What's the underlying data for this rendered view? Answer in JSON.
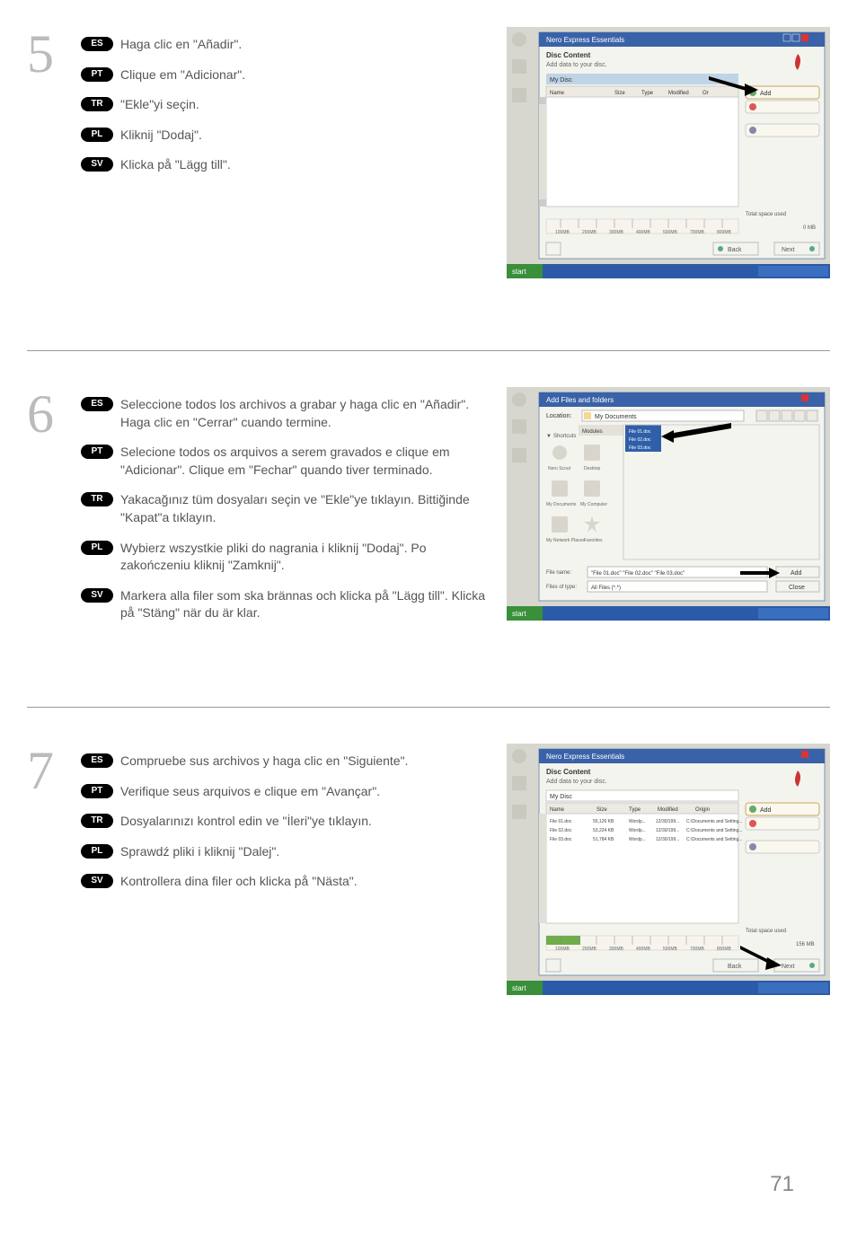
{
  "page_number": "71",
  "steps": [
    {
      "num": "5",
      "lines": [
        {
          "badge": "ES",
          "text": "Haga clic en \"Añadir\"."
        },
        {
          "badge": "PT",
          "text": "Clique em \"Adicionar\"."
        },
        {
          "badge": "TR",
          "text": "\"Ekle\"yi seçin."
        },
        {
          "badge": "PL",
          "text": "Kliknij \"Dodaj\"."
        },
        {
          "badge": "SV",
          "text": "Klicka på \"Lägg till\"."
        }
      ],
      "screenshot": {
        "title": "Nero Express Essentials",
        "heading": "Disc Content",
        "sub": "Add data to your disc.",
        "columns": [
          "Name",
          "Size",
          "Type",
          "Modified",
          "Or"
        ],
        "side_total": "Total space used",
        "side_add": "Add",
        "back": "Back",
        "next": "Next",
        "taskbar": "start",
        "arrow_to": "add"
      }
    },
    {
      "num": "6",
      "lines": [
        {
          "badge": "ES",
          "text": "Seleccione todos los archivos a grabar y haga clic en \"Añadir\". Haga clic en \"Cerrar\" cuando termine."
        },
        {
          "badge": "PT",
          "text": "Selecione todos os arquivos a serem gravados e clique em \"Adicionar\". Clique em \"Fechar\" quando tiver terminado."
        },
        {
          "badge": "TR",
          "text": "Yakacağınız tüm dosyaları seçin ve \"Ekle\"ye tıklayın. Bittiğinde \"Kapat\"a tıklayın."
        },
        {
          "badge": "PL",
          "text": "Wybierz wszystkie pliki do nagrania i kliknij \"Dodaj\". Po zakończeniu kliknij \"Zamknij\"."
        },
        {
          "badge": "SV",
          "text": "Markera alla filer som ska brännas och klicka på \"Lägg till\". Klicka på \"Stäng\" när du är klar."
        }
      ],
      "screenshot": {
        "title": "Add Files and folders",
        "location": "Location:",
        "location_val": "My Documents",
        "modules": "Modules",
        "shortcuts": "Shortcuts",
        "places": [
          "Nero Scout",
          "Desktop",
          "My Documents",
          "My Computer",
          "My Network Places",
          "Favorites"
        ],
        "filename": "File name:",
        "filename_val": "\"File 01.doc\" \"File 02.doc\" \"File 03.doc\"",
        "filesoftype": "Files of type:",
        "filesoftype_val": "All Files (*.*)",
        "add": "Add",
        "close": "Close",
        "taskbar": "start",
        "arrow_to": "list"
      }
    },
    {
      "num": "7",
      "lines": [
        {
          "badge": "ES",
          "text": "Compruebe sus archivos y haga clic en \"Siguiente\"."
        },
        {
          "badge": "PT",
          "text": "Verifique seus arquivos e clique em \"Avançar\"."
        },
        {
          "badge": "TR",
          "text": "Dosyalarınızı kontrol edin ve \"İleri\"ye tıklayın."
        },
        {
          "badge": "PL",
          "text": "Sprawdź pliki i kliknij \"Dalej\"."
        },
        {
          "badge": "SV",
          "text": "Kontrollera dina filer och klicka på \"Nästa\"."
        }
      ],
      "screenshot": {
        "title": "Nero Express Essentials",
        "heading": "Disc Content",
        "sub": "Add data to your disc.",
        "mydisc": "My Disc",
        "cols": [
          "Name",
          "Size",
          "Type",
          "Modified",
          "Origin"
        ],
        "rows": [
          [
            "File 01.doc",
            "55,126 KB",
            "Wordp...",
            "12/30/199...",
            "C:\\Documents and Setting..."
          ],
          [
            "File 02.doc",
            "53,224 KB",
            "Wordp...",
            "12/30/199...",
            "C:\\Documents and Setting..."
          ],
          [
            "File 03.doc",
            "51,784 KB",
            "Wordp...",
            "12/30/199...",
            "C:\\Documents and Setting..."
          ]
        ],
        "side_total": "Total space used",
        "side_val": "156 MB",
        "side_add": "Add",
        "back": "Back",
        "next": "Next",
        "taskbar": "start",
        "arrow_to": "next"
      }
    }
  ]
}
